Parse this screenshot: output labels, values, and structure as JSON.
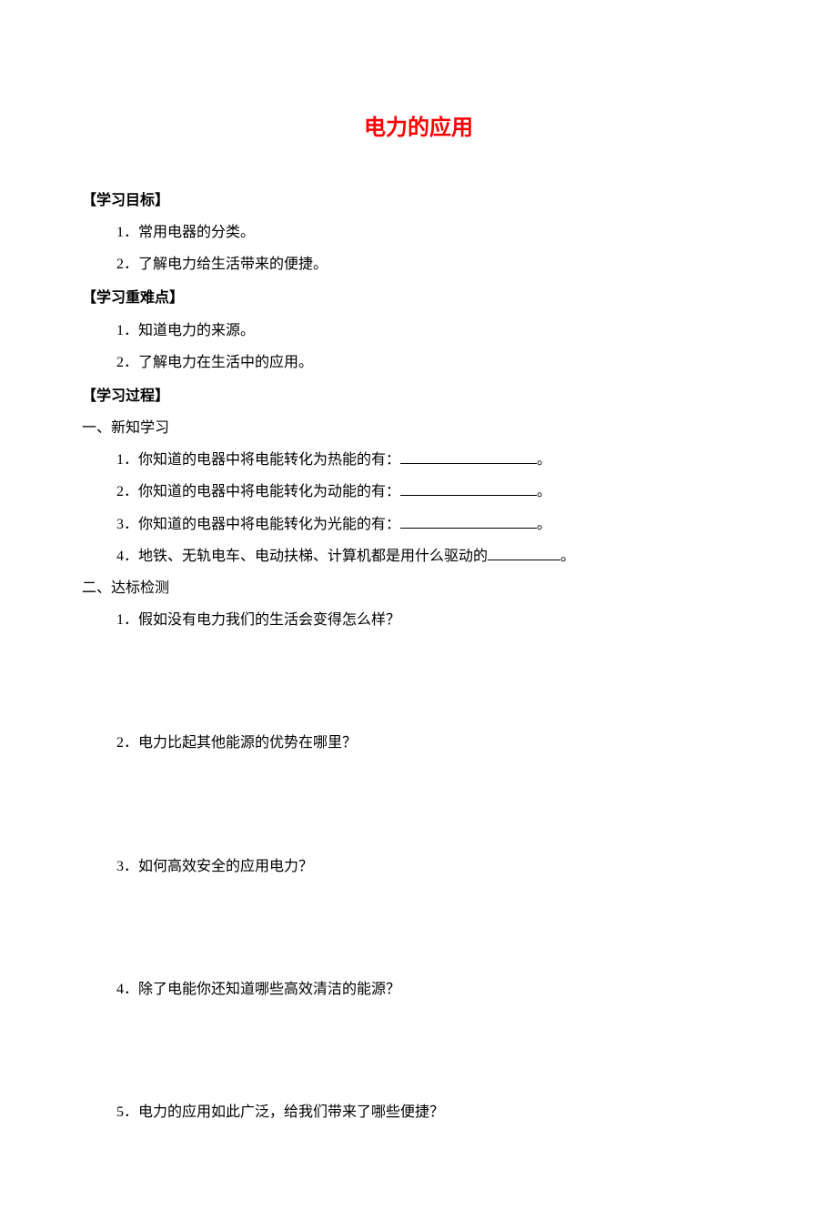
{
  "title": "电力的应用",
  "sections": {
    "objectives": {
      "header": "【学习目标】",
      "items": [
        "1．常用电器的分类。",
        "2．了解电力给生活带来的便捷。"
      ]
    },
    "keypoints": {
      "header": "【学习重难点】",
      "items": [
        "1．知道电力的来源。",
        "2．了解电力在生活中的应用。"
      ]
    },
    "process": {
      "header": "【学习过程】",
      "part1": {
        "label": "一、新知学习",
        "q1_pre": "1．你知道的电器中将电能转化为热能的有：",
        "q1_post": "。",
        "q2_pre": "2．你知道的电器中将电能转化为动能的有：",
        "q2_post": "。",
        "q3_pre": "3．你知道的电器中将电能转化为光能的有：",
        "q3_post": "。",
        "q4_pre": "4．地铁、无轨电车、电动扶梯、计算机都是用什么驱动的",
        "q4_post": "。"
      },
      "part2": {
        "label": "二、达标检测",
        "q1": "1．假如没有电力我们的生活会变得怎么样？",
        "q2": "2．电力比起其他能源的优势在哪里？",
        "q3": "3．如何高效安全的应用电力？",
        "q4": "4．除了电能你还知道哪些高效清洁的能源？",
        "q5": "5．电力的应用如此广泛，给我们带来了哪些便捷？"
      }
    }
  }
}
